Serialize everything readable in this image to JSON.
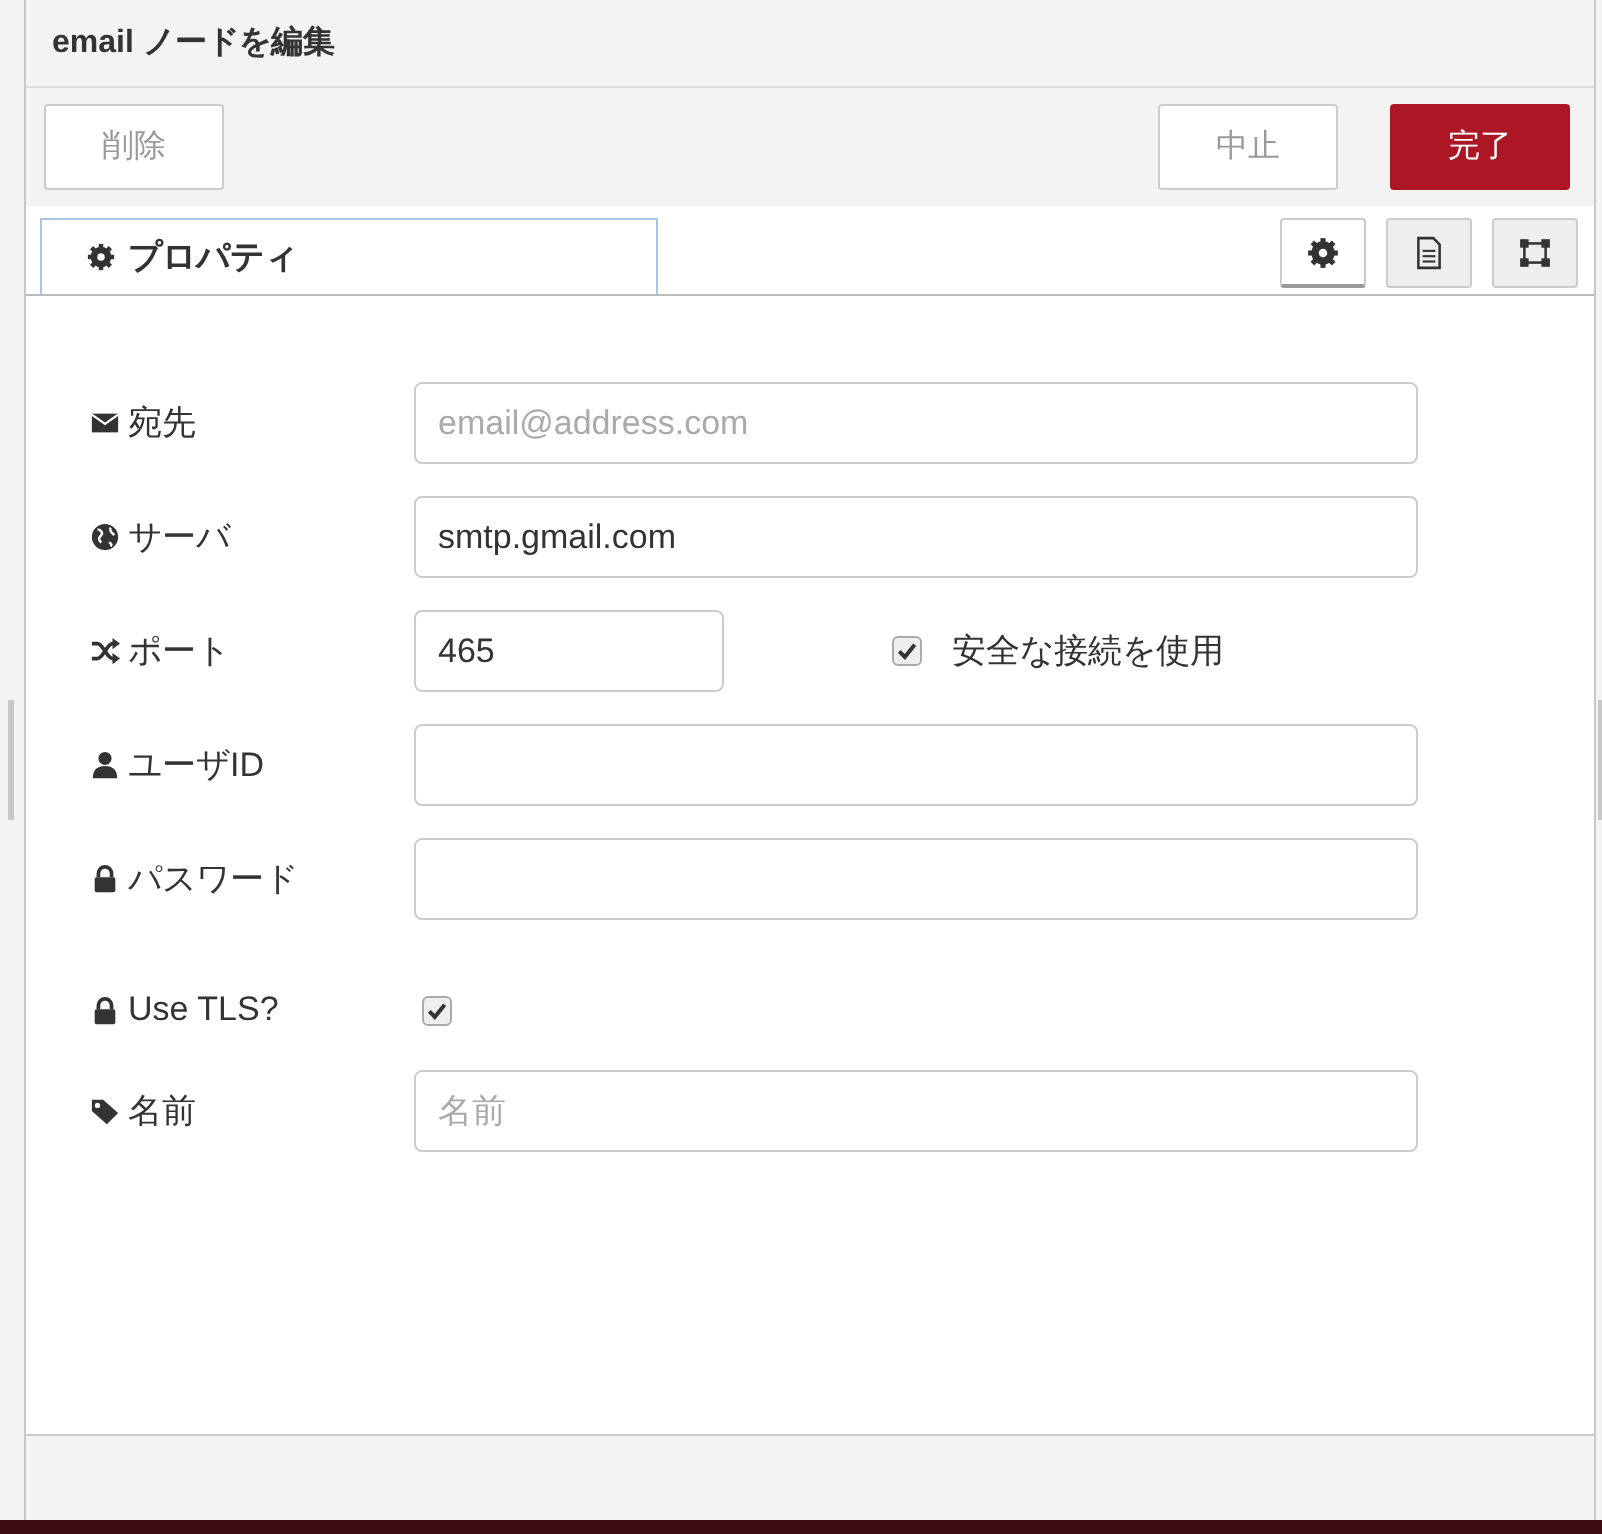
{
  "window": {
    "title": "email ノードを編集"
  },
  "buttons": [
    {
      "label": "削除",
      "kind": "plain"
    },
    {
      "label": "中止",
      "kind": "plain"
    },
    {
      "label": "完了",
      "kind": "primary"
    }
  ],
  "tabs": [
    {
      "label": "プロパティ",
      "selected": true
    }
  ],
  "tab_tools": [
    {
      "selected": true
    },
    {
      "selected": false
    },
    {
      "selected": false
    }
  ],
  "fields": [
    {
      "label": "宛先",
      "kind": "input",
      "placeholder": "email@address.com"
    },
    {
      "label": "サーバ",
      "kind": "input",
      "value": "smtp.gmail.com"
    },
    {
      "label": "ポート",
      "kind": "port",
      "value": "465",
      "option": {
        "label": "安全な接続を使用",
        "checked": true
      }
    },
    {
      "label": "ユーザID",
      "kind": "input"
    },
    {
      "label": "パスワード",
      "kind": "input"
    },
    {
      "label": "Use TLS?",
      "kind": "checkbox",
      "checked": true
    },
    {
      "label": "名前",
      "kind": "input",
      "placeholder": "名前"
    }
  ]
}
